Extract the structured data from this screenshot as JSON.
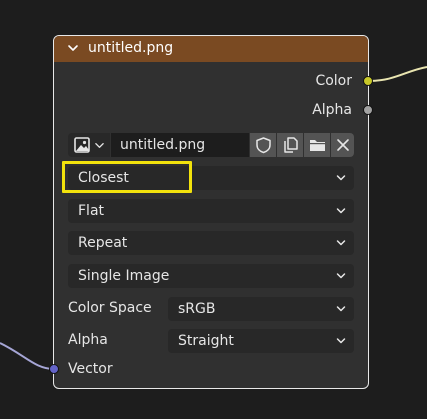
{
  "node": {
    "title": "untitled.png",
    "outputs": [
      {
        "label": "Color",
        "socket_color": "#c7c729"
      },
      {
        "label": "Alpha",
        "socket_color": "#a1a1a1"
      }
    ],
    "image_field": {
      "value": "untitled.png",
      "type_icon": "image-icon",
      "buttons": [
        "fake-user-shield-icon",
        "duplicate-image-icon",
        "open-folder-icon",
        "close-icon"
      ]
    },
    "interpolation": {
      "value": "Closest",
      "highlighted": true
    },
    "projection": {
      "value": "Flat"
    },
    "extension": {
      "value": "Repeat"
    },
    "source": {
      "value": "Single Image"
    },
    "color_space": {
      "label": "Color Space",
      "value": "sRGB"
    },
    "alpha": {
      "label": "Alpha",
      "value": "Straight"
    },
    "input": {
      "label": "Vector",
      "socket_color": "#6363c7"
    }
  },
  "colors": {
    "header": "#7a4a22",
    "node_body": "#303030",
    "highlight": "#f2e20c",
    "background": "#1d1d1d"
  }
}
